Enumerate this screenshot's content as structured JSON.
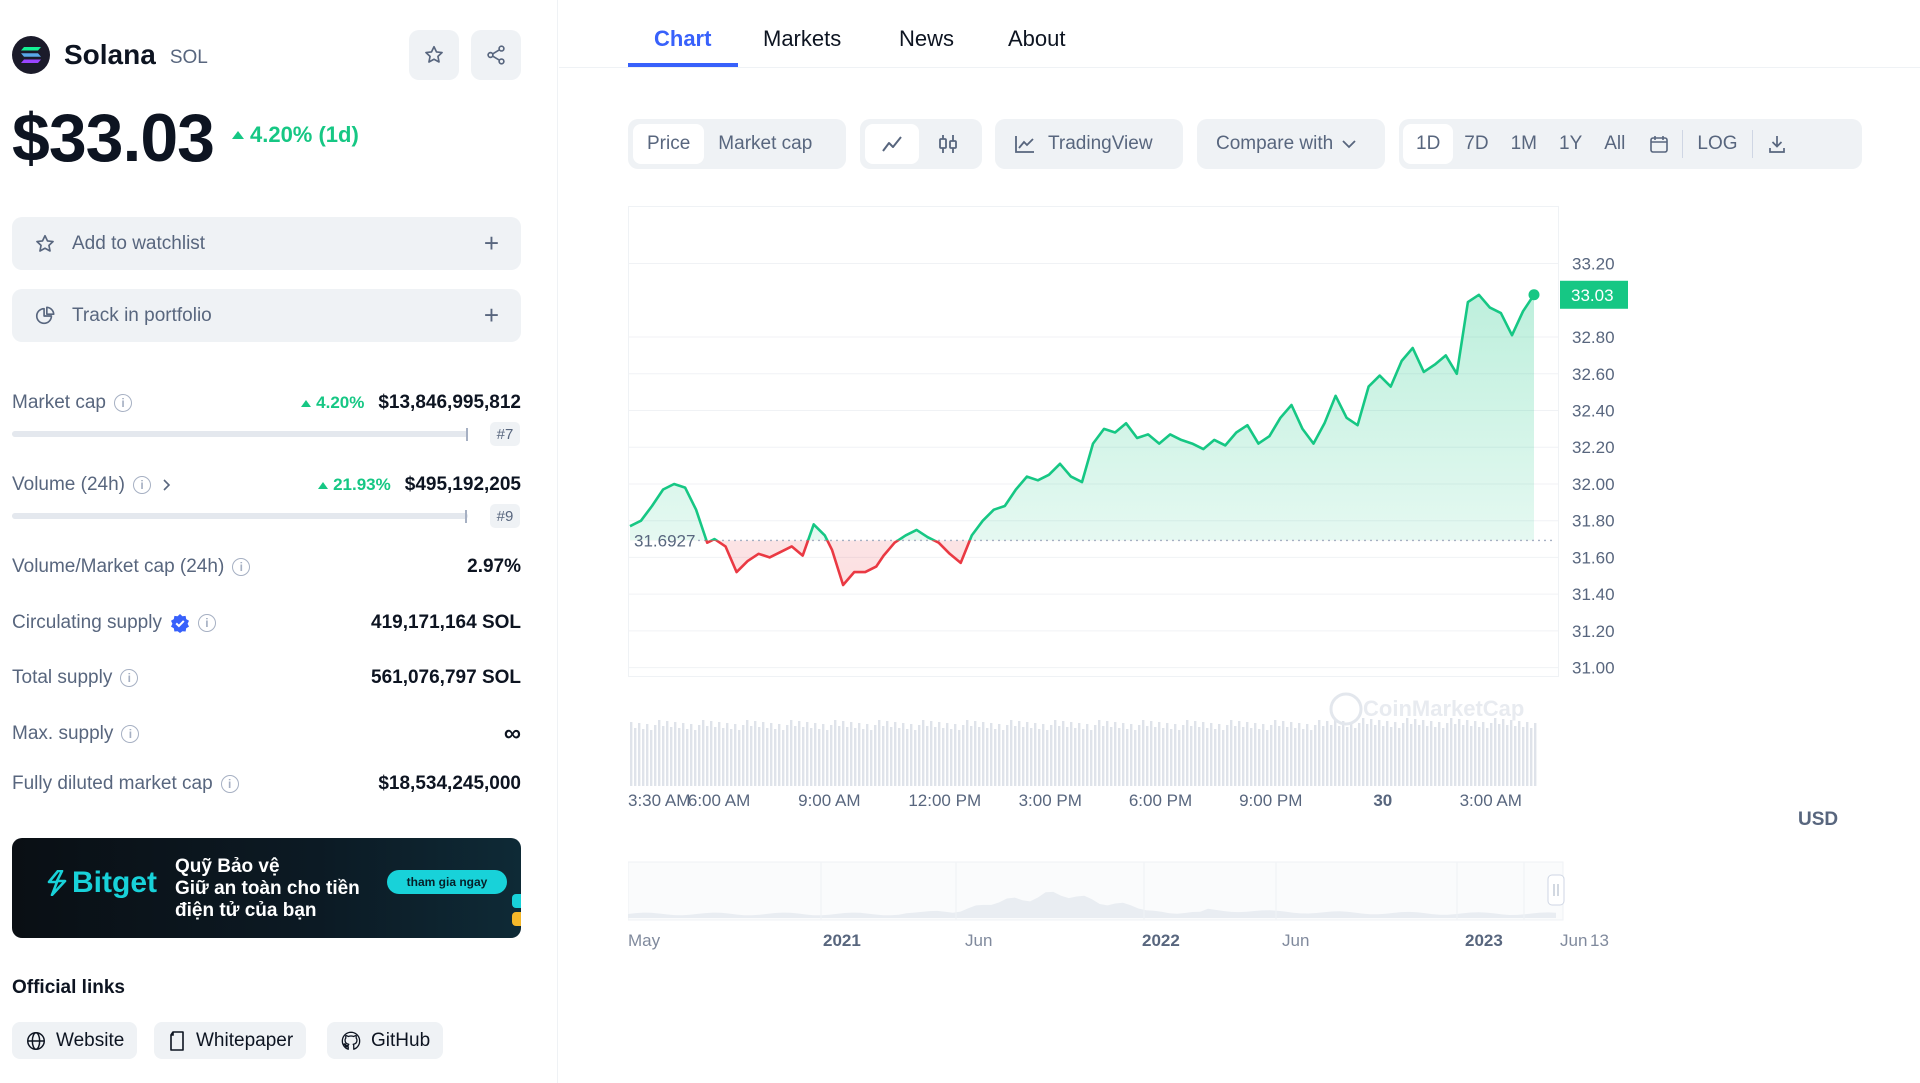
{
  "coin": {
    "name": "Solana",
    "symbol": "SOL",
    "price": "$33.03",
    "change_1d": "4.20% (1d)"
  },
  "actions": {
    "watchlist": "Add to watchlist",
    "portfolio": "Track in portfolio",
    "plus": "+"
  },
  "stats": {
    "market_cap": {
      "label": "Market cap",
      "change": "4.20%",
      "value": "$13,846,995,812",
      "rank": "#7"
    },
    "volume": {
      "label": "Volume (24h)",
      "change": "21.93%",
      "value": "$495,192,205",
      "rank": "#9"
    },
    "vol_mcap": {
      "label": "Volume/Market cap (24h)",
      "value": "2.97%"
    },
    "circulating": {
      "label": "Circulating supply",
      "value": "419,171,164 SOL"
    },
    "total": {
      "label": "Total supply",
      "value": "561,076,797 SOL"
    },
    "max": {
      "label": "Max. supply",
      "value": "∞"
    },
    "fdmc": {
      "label": "Fully diluted market cap",
      "value": "$18,534,245,000"
    }
  },
  "ad": {
    "brand": "Bitget",
    "line1": "Quỹ Bảo vệ",
    "line2": "Giữ an toàn cho tiền",
    "line3": "điện tử của bạn",
    "cta": "tham gia ngay"
  },
  "links": {
    "title": "Official links",
    "website": "Website",
    "whitepaper": "Whitepaper",
    "github": "GitHub"
  },
  "tabs": [
    "Chart",
    "Markets",
    "News",
    "About"
  ],
  "toolbar": {
    "price": "Price",
    "market_cap": "Market cap",
    "tradingview": "TradingView",
    "compare": "Compare with",
    "ranges": [
      "1D",
      "7D",
      "1M",
      "1Y",
      "All"
    ],
    "log": "LOG"
  },
  "colors": {
    "up": "#16c784",
    "down": "#ea3943",
    "accent": "#3861fb"
  },
  "chart_data": {
    "type": "line",
    "currency_label": "USD",
    "reference_price": 31.6927,
    "reference_label": "31.6927",
    "current_price": 33.03,
    "current_label": "33.03",
    "ylim": [
      30.9,
      33.35
    ],
    "y_ticks": [
      "33.20",
      "32.80",
      "32.60",
      "32.40",
      "32.20",
      "32.00",
      "31.80",
      "31.60",
      "31.40",
      "31.20",
      "31.00"
    ],
    "y_tick_values": [
      33.2,
      32.8,
      32.6,
      32.4,
      32.2,
      32.0,
      31.8,
      31.6,
      31.4,
      31.2,
      31.0
    ],
    "x_ticks": [
      "3:30 AM",
      "6:00 AM",
      "9:00 AM",
      "12:00 PM",
      "3:00 PM",
      "6:00 PM",
      "9:00 PM",
      "30",
      "3:00 AM"
    ],
    "x_tick_hours": [
      0,
      2.5,
      5.5,
      8.5,
      11.5,
      14.5,
      17.5,
      20.5,
      23.5
    ],
    "series": [
      {
        "x_hours": [
          0,
          0.3,
          0.6,
          0.9,
          1.2,
          1.5,
          1.8,
          2.1,
          2.3,
          2.6,
          2.9,
          3.2,
          3.5,
          3.8,
          4.1,
          4.4,
          4.7,
          5.0,
          5.3,
          5.5,
          5.8,
          6.1,
          6.4,
          6.7,
          6.9,
          7.2,
          7.5,
          7.8,
          8.1,
          8.4,
          8.7,
          9.0,
          9.3,
          9.6,
          9.9,
          10.2,
          10.5,
          10.8,
          11.1,
          11.4,
          11.7,
          12.0,
          12.3,
          12.6,
          12.9,
          13.2,
          13.5,
          13.8,
          14.1,
          14.4,
          14.7,
          15.0,
          15.3,
          15.6,
          15.9,
          16.2,
          16.5,
          16.8,
          17.1,
          17.4,
          17.7,
          18.0,
          18.3,
          18.6,
          18.9,
          19.2,
          19.5,
          19.8,
          20.1,
          20.4,
          20.7,
          21.0,
          21.3,
          21.6,
          21.9,
          22.2,
          22.5,
          22.8,
          23.1,
          23.4,
          23.7,
          24.0,
          24.3,
          24.6
        ],
        "values": [
          31.77,
          31.8,
          31.88,
          31.97,
          32.0,
          31.98,
          31.86,
          31.68,
          31.7,
          31.66,
          31.52,
          31.58,
          31.62,
          31.6,
          31.63,
          31.66,
          31.61,
          31.78,
          31.72,
          31.64,
          31.45,
          31.52,
          31.52,
          31.55,
          31.61,
          31.68,
          31.72,
          31.75,
          31.71,
          31.68,
          31.62,
          31.57,
          31.72,
          31.8,
          31.86,
          31.88,
          31.97,
          32.04,
          32.02,
          32.05,
          32.11,
          32.04,
          32.01,
          32.22,
          32.3,
          32.28,
          32.33,
          32.25,
          32.27,
          32.22,
          32.27,
          32.24,
          32.22,
          32.19,
          32.24,
          32.21,
          32.28,
          32.32,
          32.22,
          32.26,
          32.36,
          32.43,
          32.3,
          32.22,
          32.33,
          32.48,
          32.36,
          32.32,
          32.53,
          32.59,
          32.53,
          32.67,
          32.74,
          32.61,
          32.65,
          32.7,
          32.6,
          32.99,
          33.03,
          32.96,
          32.93,
          32.81,
          32.94,
          33.03
        ],
        "color_above_reference": "#16c784",
        "color_below_reference": "#ea3943"
      }
    ],
    "navigator_labels": [
      "May",
      "2021",
      "Jun",
      "2022",
      "Jun",
      "2023",
      "Jun",
      "13"
    ],
    "navigator_label_bold": [
      false,
      true,
      false,
      true,
      false,
      true,
      false,
      false
    ],
    "watermark": "CoinMarketCap"
  }
}
